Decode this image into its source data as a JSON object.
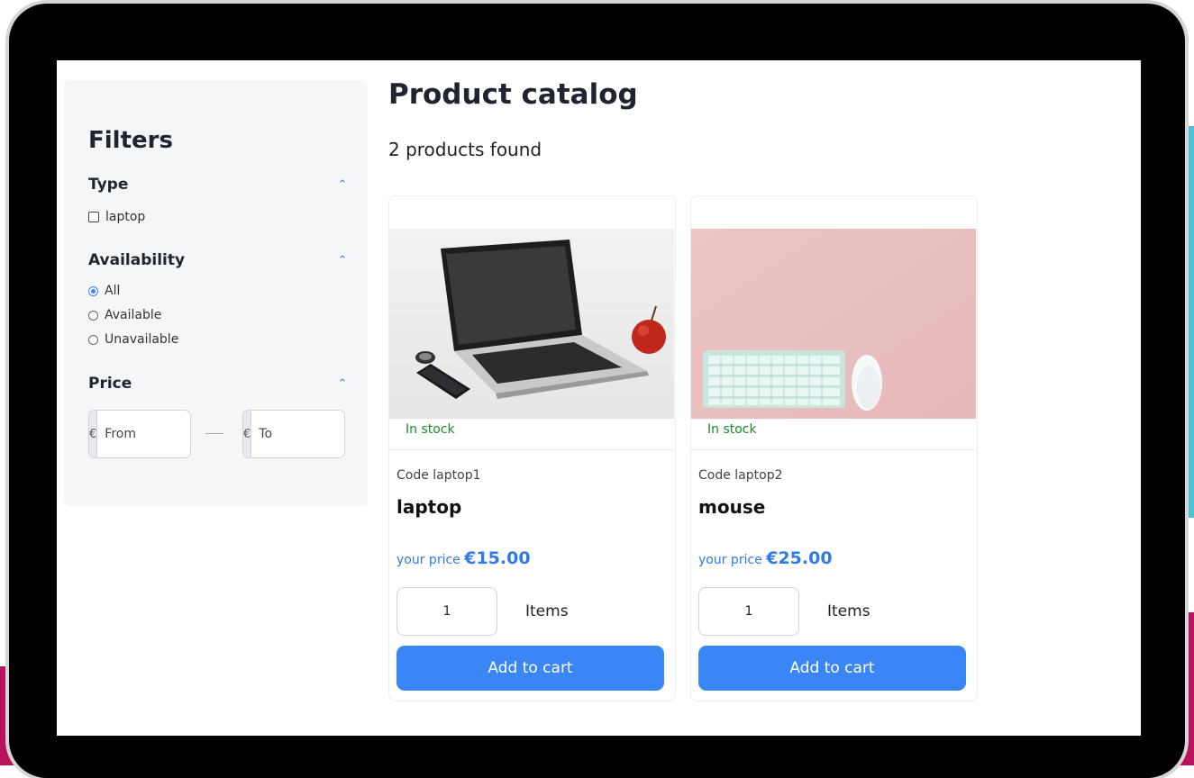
{
  "colors": {
    "accent": "#3b86f7",
    "in_stock": "#1a8a2e",
    "price": "#2f7ae5"
  },
  "filters": {
    "title": "Filters",
    "type": {
      "title": "Type",
      "options": [
        "laptop"
      ]
    },
    "availability": {
      "title": "Availability",
      "options": [
        "All",
        "Available",
        "Unavailable"
      ],
      "selected": "All"
    },
    "price": {
      "title": "Price",
      "currency": "€",
      "from_placeholder": "From",
      "to_placeholder": "To"
    }
  },
  "catalog": {
    "title": "Product catalog",
    "count_text": "2 products found",
    "products": [
      {
        "status": "In stock",
        "code": "Code laptop1",
        "name": "laptop",
        "price_label": "your price",
        "price": "€15.00",
        "quantity": "1",
        "items_label": "Items",
        "button": "Add to cart"
      },
      {
        "status": "In stock",
        "code": "Code laptop2",
        "name": "mouse",
        "price_label": "your price",
        "price": "€25.00",
        "quantity": "1",
        "items_label": "Items",
        "button": "Add to cart"
      }
    ]
  }
}
